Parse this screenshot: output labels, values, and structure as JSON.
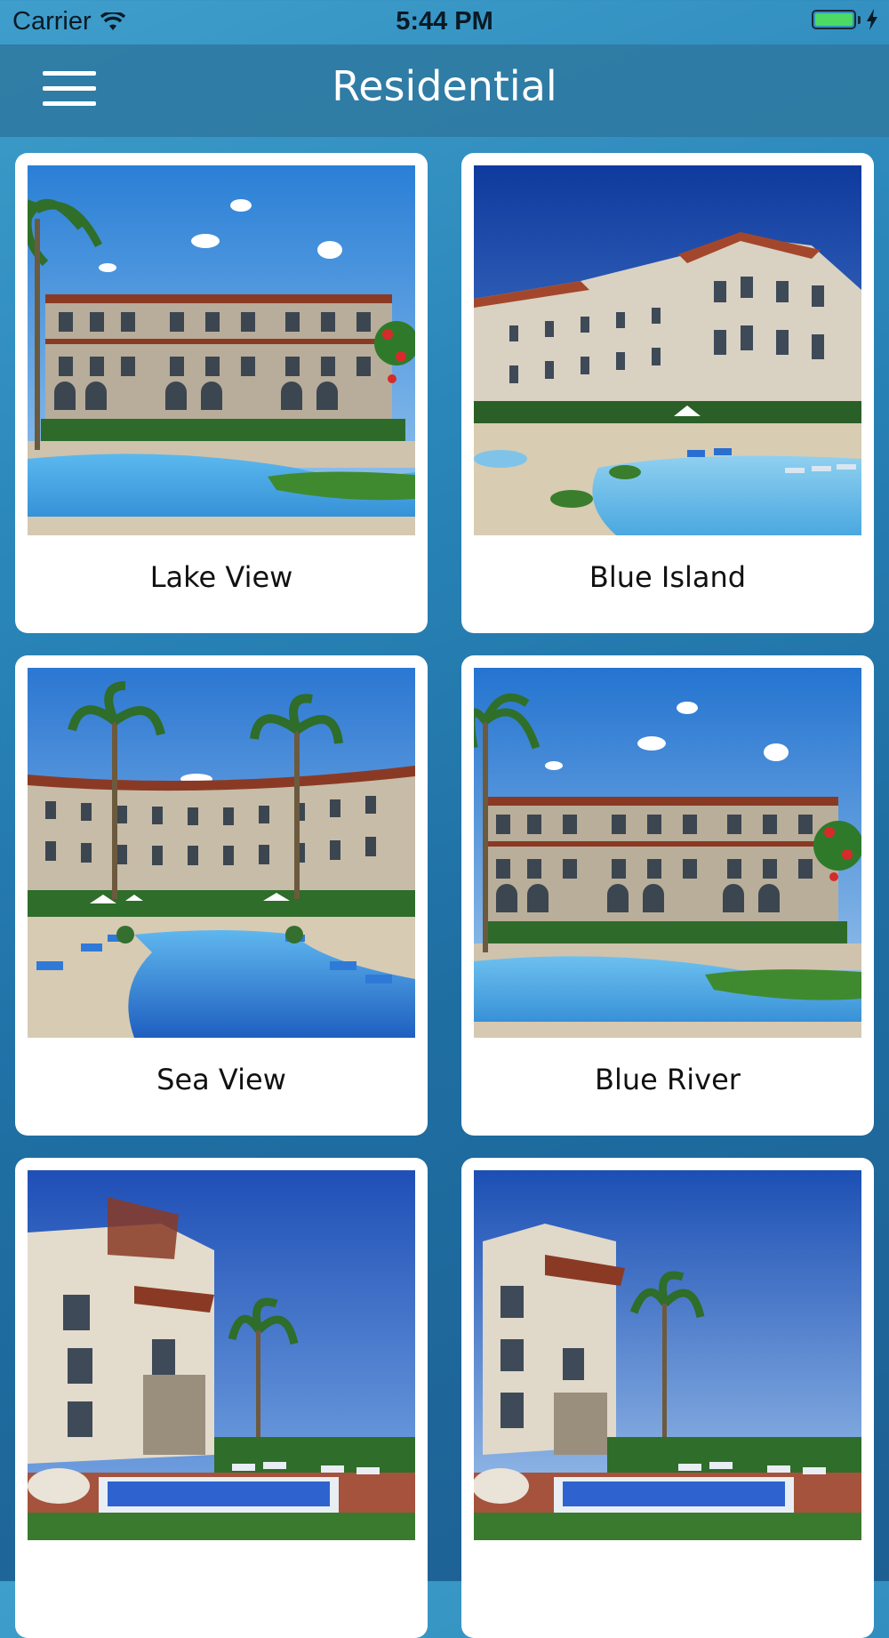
{
  "status_bar": {
    "carrier": "Carrier",
    "time": "5:44 PM"
  },
  "nav": {
    "title": "Residential"
  },
  "projects": [
    {
      "name": "Lake View"
    },
    {
      "name": "Blue Island"
    },
    {
      "name": "Sea View"
    },
    {
      "name": "Blue River"
    },
    {
      "name": ""
    },
    {
      "name": ""
    }
  ],
  "colors": {
    "background": "#2a86b9",
    "navbar": "#2e78a0",
    "card": "#ffffff",
    "battery": "#4cd964"
  }
}
